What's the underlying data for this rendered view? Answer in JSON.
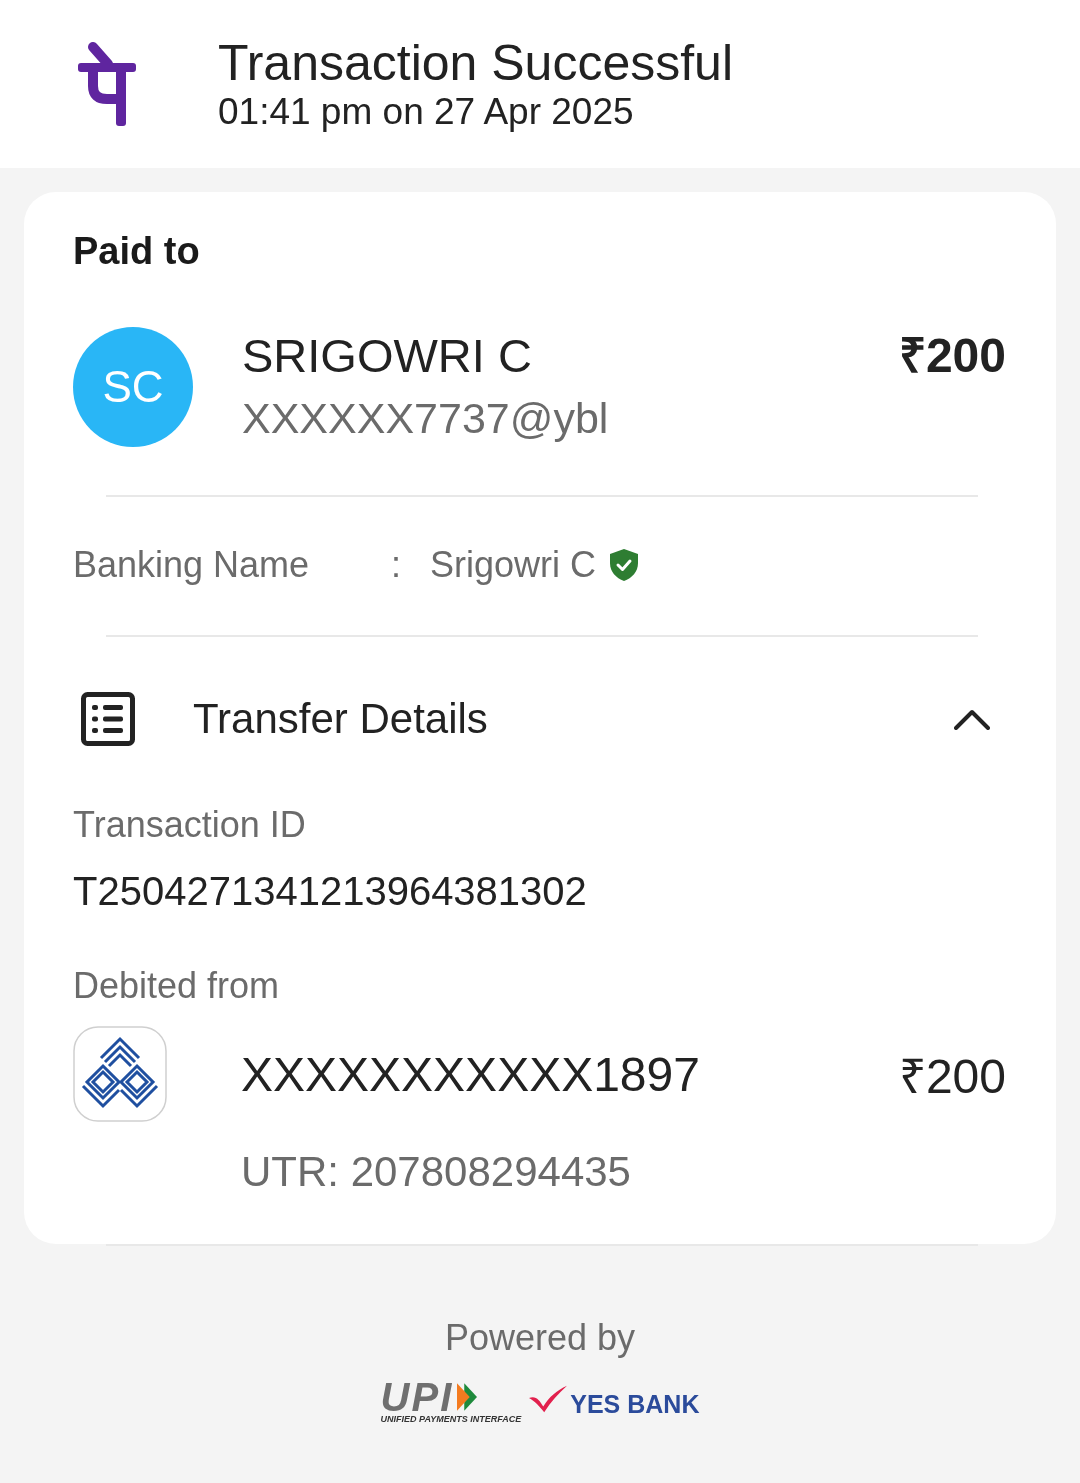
{
  "header": {
    "title": "Transaction Successful",
    "timestamp": "01:41 pm on 27 Apr 2025"
  },
  "paid_to": {
    "heading": "Paid to",
    "avatar_initials": "SC",
    "name": "SRIGOWRI C",
    "upi_id": "XXXXXX7737@ybl",
    "amount": "₹200"
  },
  "banking_name": {
    "label": "Banking Name",
    "separator": ":",
    "value": "Srigowri C",
    "verified": true
  },
  "transfer_details": {
    "title": "Transfer Details",
    "expanded": true,
    "transaction_id": {
      "label": "Transaction ID",
      "value": "T2504271341213964381302"
    },
    "debited_from": {
      "label": "Debited from",
      "account": "XXXXXXXXXXX1897",
      "amount": "₹200",
      "utr": "UTR: 207808294435"
    }
  },
  "footer": {
    "powered_by": "Powered by",
    "upi_logo": {
      "wordmark": "UPI",
      "tagline": "UNIFIED PAYMENTS INTERFACE"
    },
    "bank_logo": "YES BANK"
  }
}
